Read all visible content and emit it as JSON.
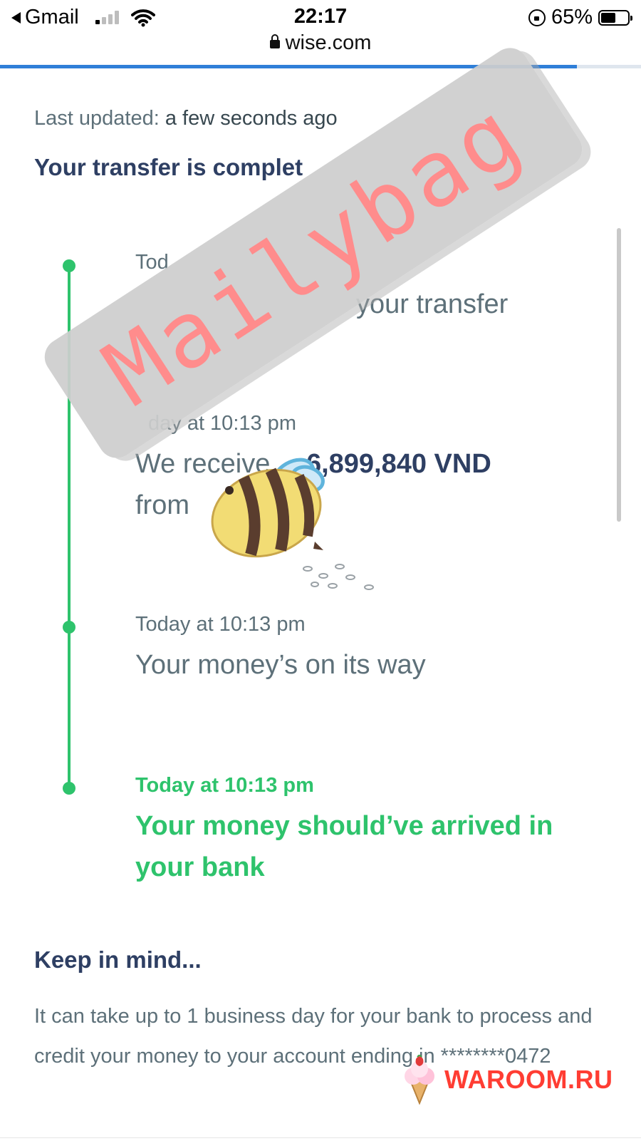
{
  "status_bar": {
    "back_app": "Gmail",
    "time": "22:17",
    "battery_percent": "65%",
    "battery_level": 0.65,
    "signal_bars_active": 1
  },
  "browser": {
    "url": "wise.com",
    "page_load_progress": 0.9
  },
  "transfer": {
    "last_updated_label": "Last updated:",
    "last_updated_value": "a few seconds ago",
    "status_heading": "Your transfer is complet"
  },
  "timeline": [
    {
      "time": "Tod",
      "text": "your transfer"
    },
    {
      "time": "day at 10:13 pm",
      "text_prefix": "We receive",
      "amount": "6,899,840 VND",
      "text_suffix": "from"
    },
    {
      "time": "Today at 10:13 pm",
      "text": "Your money’s on its way"
    },
    {
      "time": "Today at 10:13 pm",
      "text": "Your money should’ve arrived in your bank"
    }
  ],
  "keep_in_mind": {
    "heading": "Keep in mind...",
    "body": "It can take up to 1 business day for your bank to process and credit your money to your account ending in ********0472"
  },
  "overlays": {
    "watermark_text": "Mailybag",
    "brand_badge_text": "WAROOM.RU"
  },
  "colors": {
    "accent_green": "#2ec36c",
    "navy": "#2e3f63",
    "body_grey": "#5d7079",
    "progress_blue": "#2f7fd8",
    "watermark_pink": "#ff8c8c",
    "badge_red": "#ff3d33"
  }
}
